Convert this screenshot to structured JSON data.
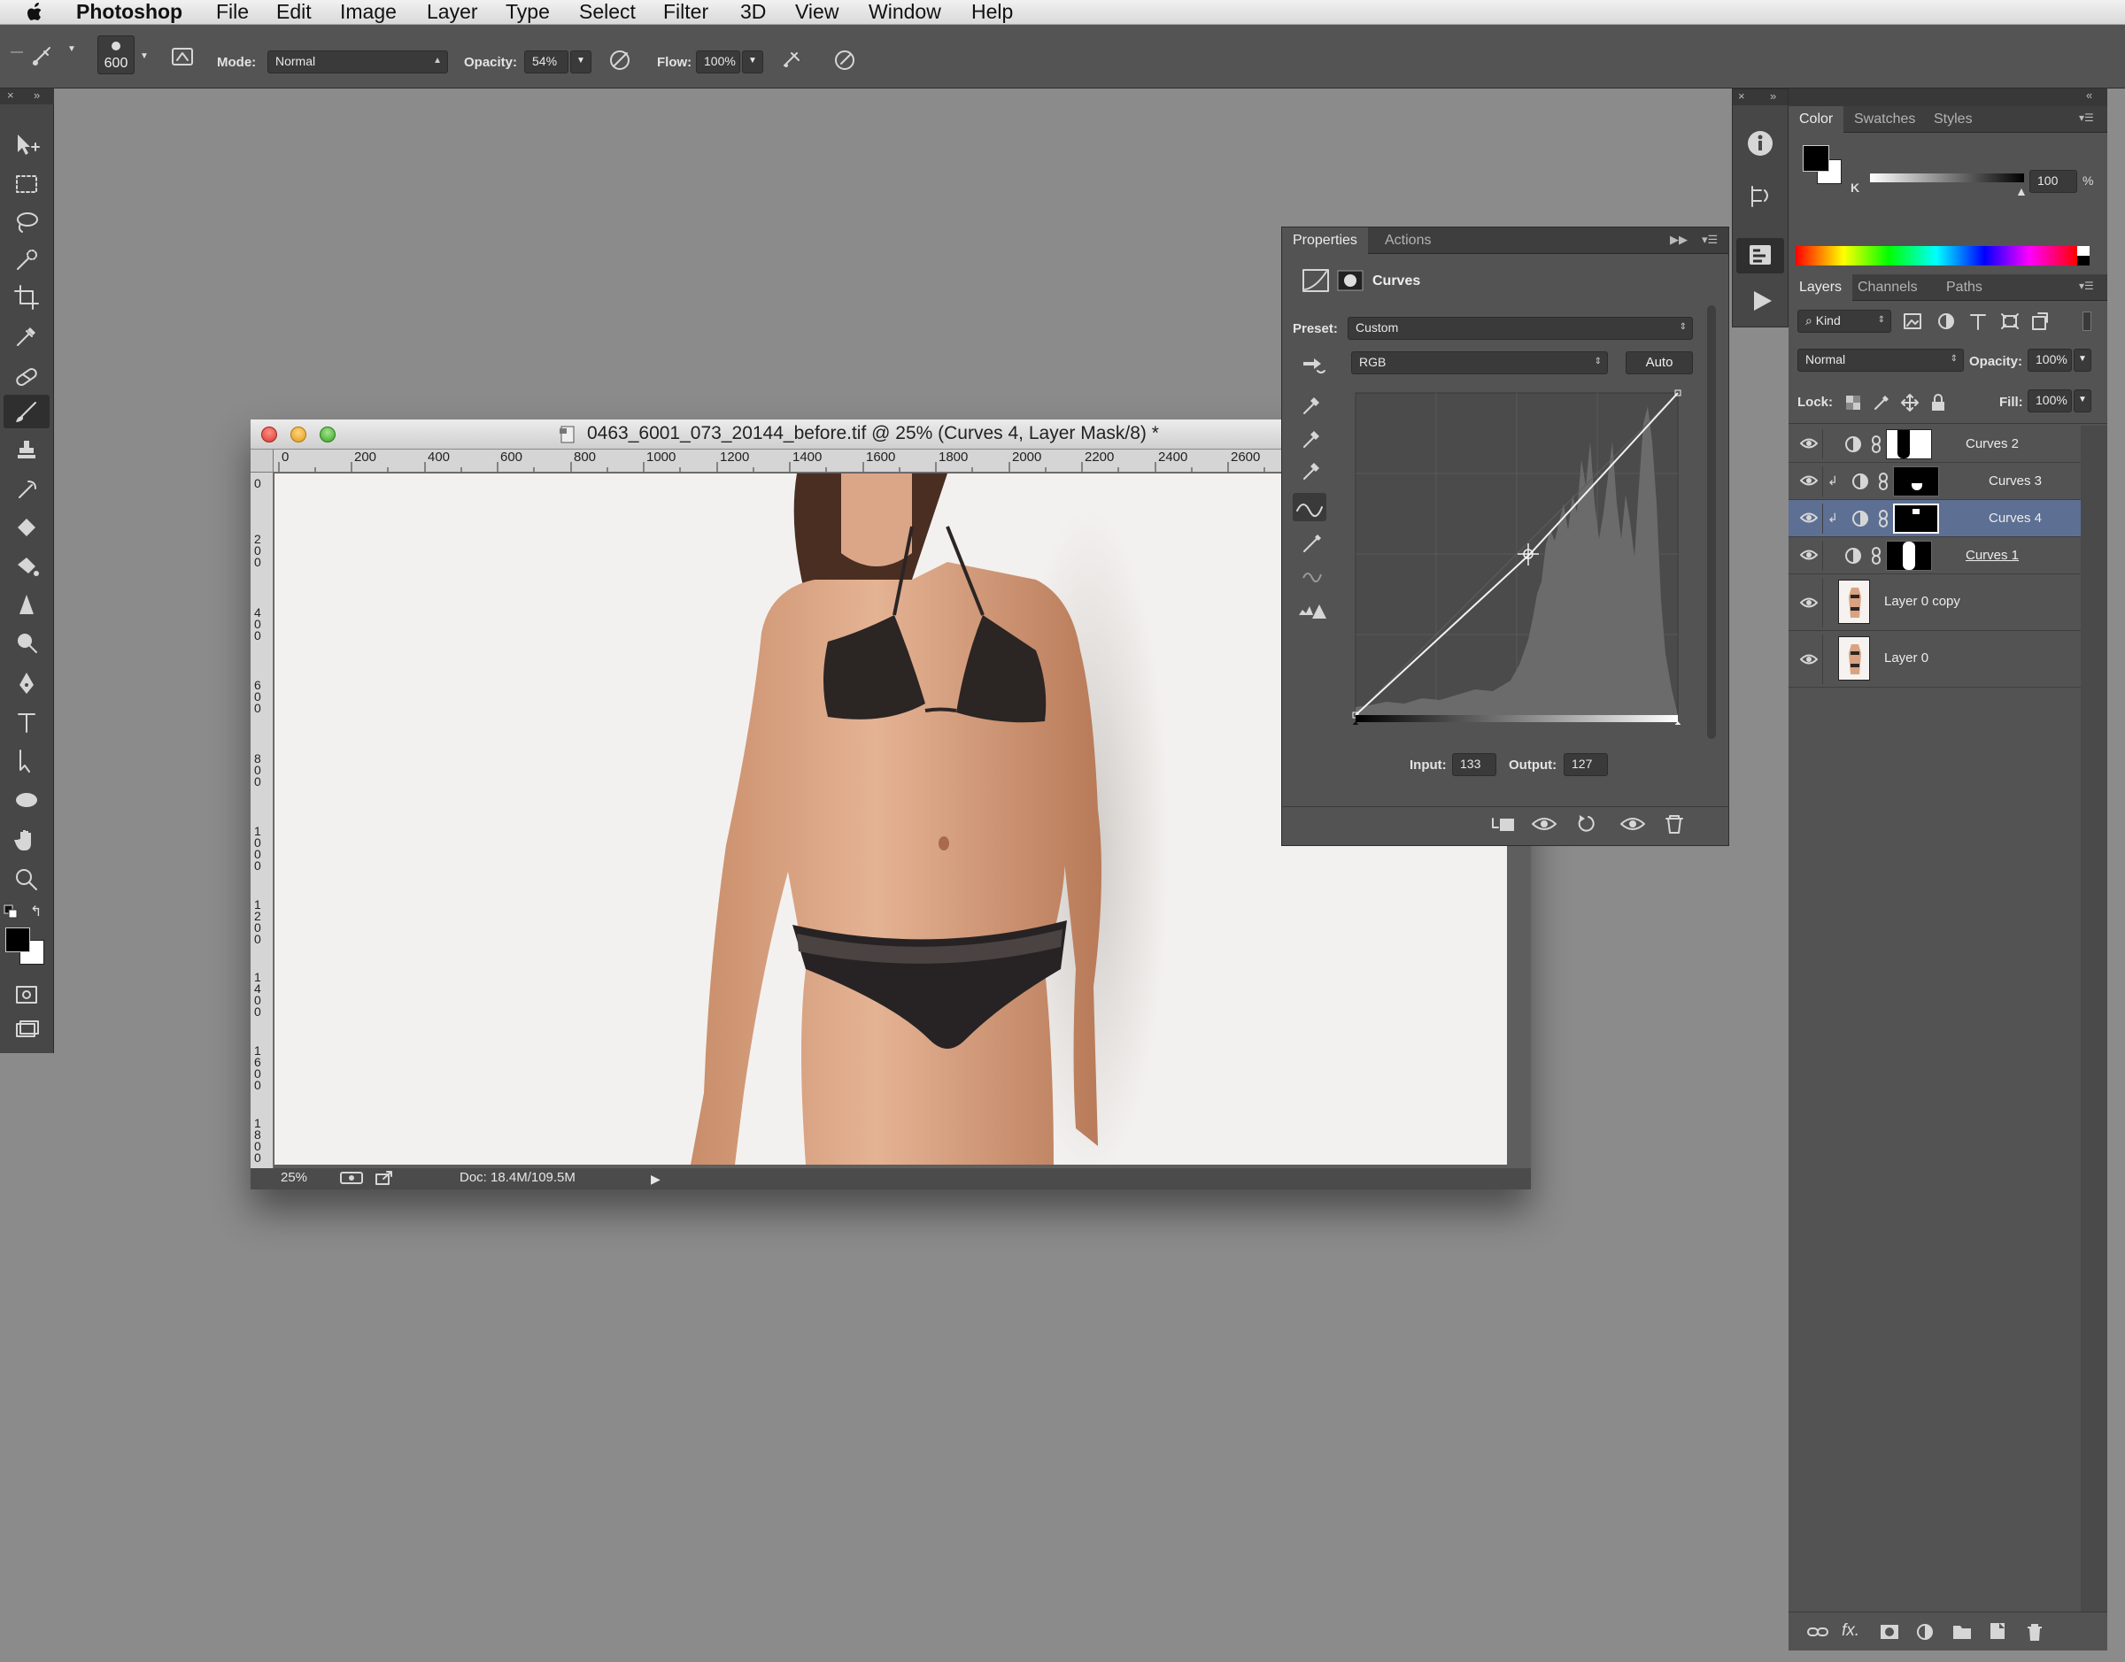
{
  "menubar": {
    "app": "Photoshop",
    "items": [
      "File",
      "Edit",
      "Image",
      "Layer",
      "Type",
      "Select",
      "Filter",
      "3D",
      "View",
      "Window",
      "Help"
    ]
  },
  "options": {
    "brush_size": "600",
    "mode_label": "Mode:",
    "mode_value": "Normal",
    "opacity_label": "Opacity:",
    "opacity_value": "54%",
    "flow_label": "Flow:",
    "flow_value": "100%"
  },
  "document": {
    "title": "0463_6001_073_20144_before.tif @ 25% (Curves 4, Layer Mask/8) *",
    "ruler_h": [
      "0",
      "200",
      "400",
      "600",
      "800",
      "1000",
      "1200",
      "1400",
      "1600",
      "1800",
      "2000",
      "2200",
      "2400",
      "2600"
    ],
    "ruler_v": [
      "0",
      "200",
      "400",
      "600",
      "800",
      "1000",
      "1200",
      "1400",
      "1600",
      "1800"
    ],
    "zoom": "25%",
    "doc_size": "Doc: 18.4M/109.5M"
  },
  "properties": {
    "tabs": [
      "Properties",
      "Actions"
    ],
    "adjustment": "Curves",
    "preset_label": "Preset:",
    "preset_value": "Custom",
    "channel_value": "RGB",
    "auto_label": "Auto",
    "input_label": "Input:",
    "input_value": "133",
    "output_label": "Output:",
    "output_value": "127"
  },
  "color_panel": {
    "tabs": [
      "Color",
      "Swatches",
      "Styles"
    ],
    "channel": "K",
    "value": "100",
    "unit": "%",
    "foreground": "#000000",
    "background": "#ffffff"
  },
  "layers_panel": {
    "tabs": [
      "Layers",
      "Channels",
      "Paths"
    ],
    "kind_label": "Kind",
    "blend_mode": "Normal",
    "opacity_label": "Opacity:",
    "opacity_value": "100%",
    "lock_label": "Lock:",
    "fill_label": "Fill:",
    "fill_value": "100%",
    "layers": [
      {
        "name": "Curves 2",
        "type": "curves",
        "selected": false
      },
      {
        "name": "Curves 3",
        "type": "curves",
        "selected": false
      },
      {
        "name": "Curves 4",
        "type": "curves",
        "selected": true
      },
      {
        "name": "Curves 1",
        "type": "curves",
        "selected": false
      },
      {
        "name": "Layer 0 copy",
        "type": "pixel",
        "selected": false
      },
      {
        "name": "Layer 0",
        "type": "pixel",
        "selected": false
      }
    ]
  }
}
